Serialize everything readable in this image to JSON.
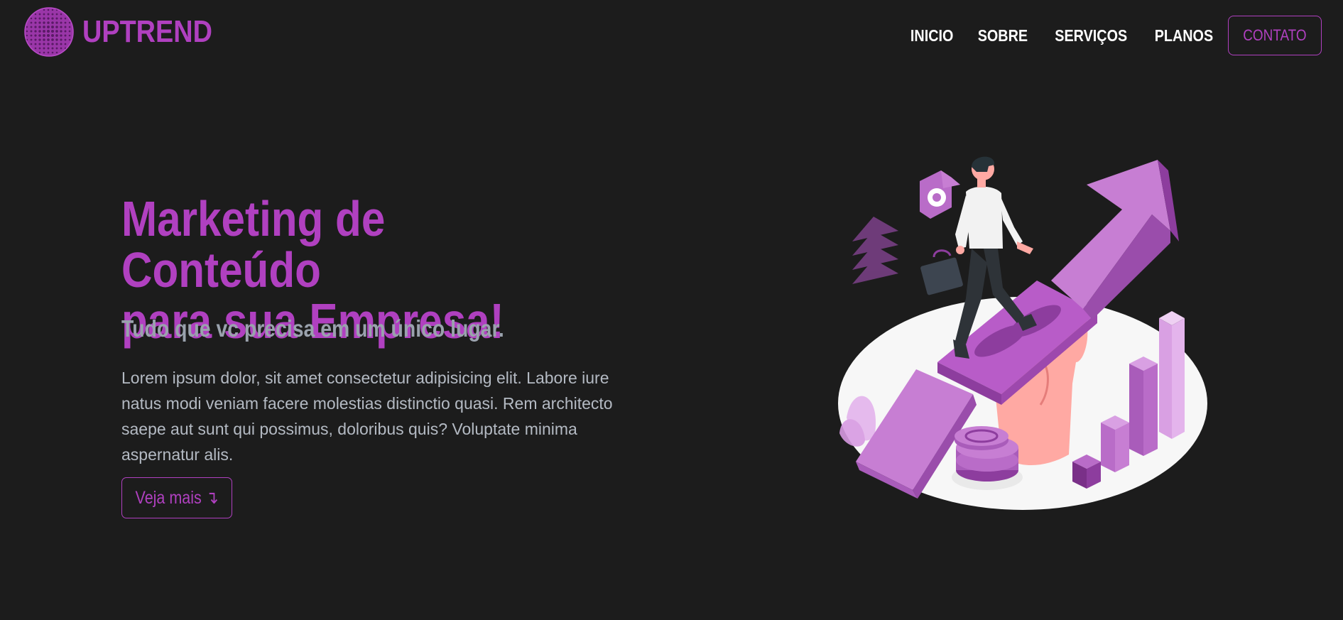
{
  "brand": {
    "name": "UPTREND",
    "logo_icon": "globe-icon"
  },
  "nav": {
    "items": [
      {
        "label": "INICIO"
      },
      {
        "label": "SOBRE"
      },
      {
        "label": "SERVIÇOS"
      },
      {
        "label": "PLANOS"
      }
    ],
    "contact_label": "CONTATO"
  },
  "hero": {
    "title_line1": "Marketing de Conteúdo",
    "title_line2": "para sua Empresa!",
    "subtitle": "Tudo que vc precisa em um único lugar.",
    "paragraph_line1": "Lorem ipsum dolor, sit amet consectetur adipisicing elit. Labore iure",
    "paragraph_line2": "natus modi veniam facere molestias distinctio quasi. Rem architecto",
    "paragraph_line3": "saepe aut sunt qui possimus, doloribus quis? Voluptate minima",
    "paragraph_line4": "aspernatur alis.",
    "cta_label": "Veja mais",
    "cta_icon": "↴"
  },
  "colors": {
    "background": "#1c1c1c",
    "accent": "#b040c0",
    "nav_text": "#ffffff",
    "subtitle": "#9aa2ad",
    "body_text": "#b4bac3"
  },
  "illustration": {
    "name": "growth-illustration"
  }
}
